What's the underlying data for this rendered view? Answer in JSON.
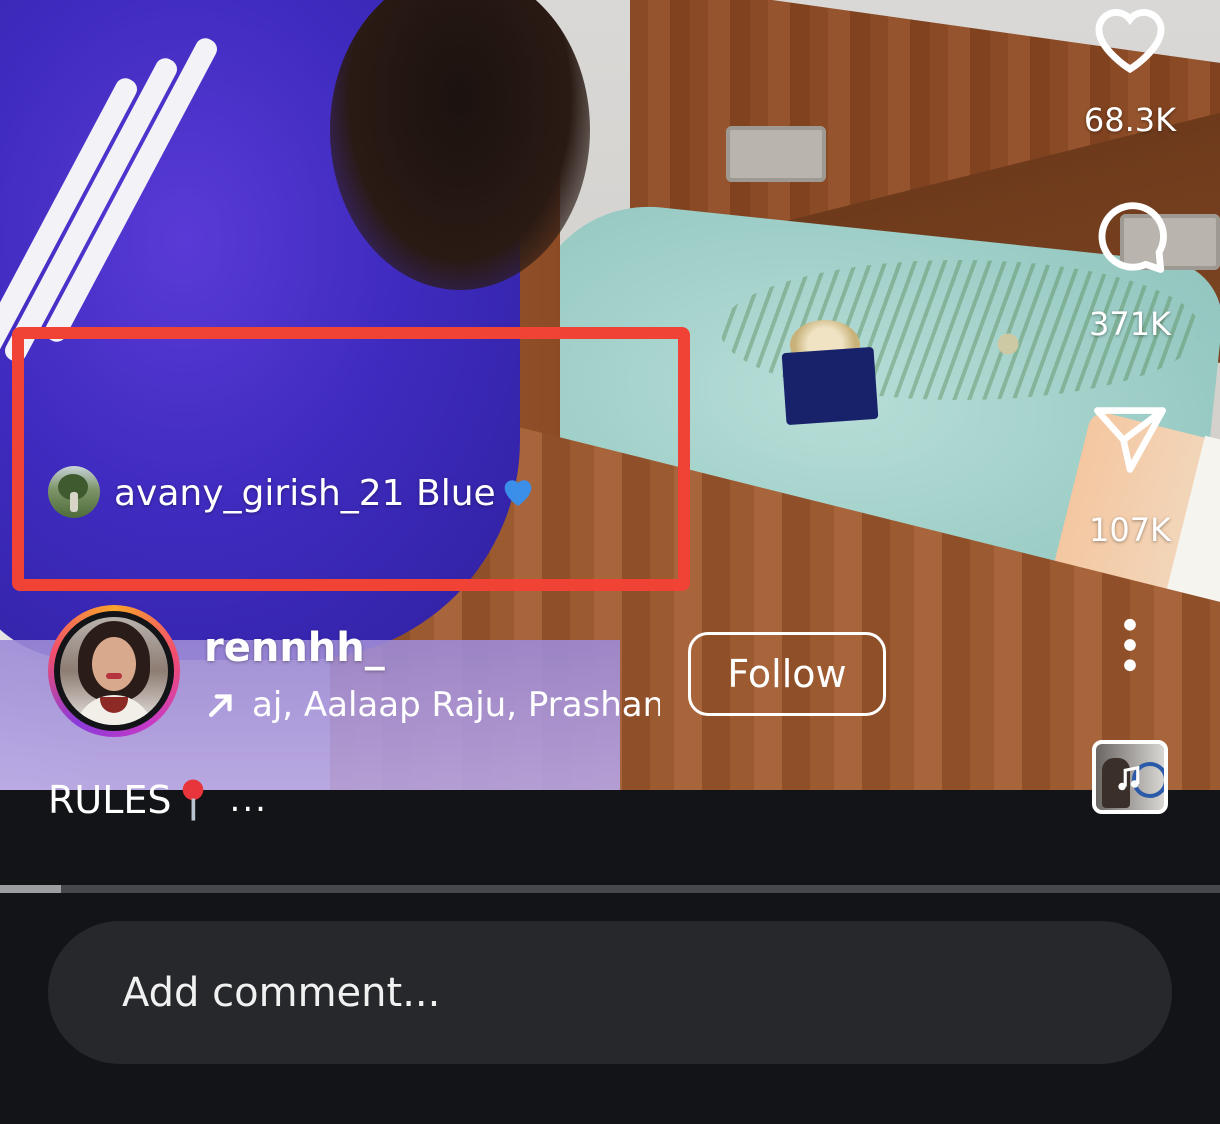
{
  "post": {
    "collaborator_text": "avany_girish_21 Blue",
    "collaborator_emoji": "blue-heart-icon",
    "username": "rennhh_",
    "audio_text": "aj, Aalaap Raju, Prashanth",
    "follow_label": "Follow",
    "caption_text": "RULES",
    "caption_more": "...",
    "highlight_color": "#f04335"
  },
  "actions": {
    "likes": "68.3K",
    "comments": "371K",
    "shares": "107K"
  },
  "progress": {
    "fraction": 0.05
  },
  "comment": {
    "placeholder": "Add comment..."
  },
  "colors": {
    "background": "#121417",
    "comment_box": "#26282c",
    "progress_track": "#45484d",
    "progress_fill": "#9b9da1"
  }
}
